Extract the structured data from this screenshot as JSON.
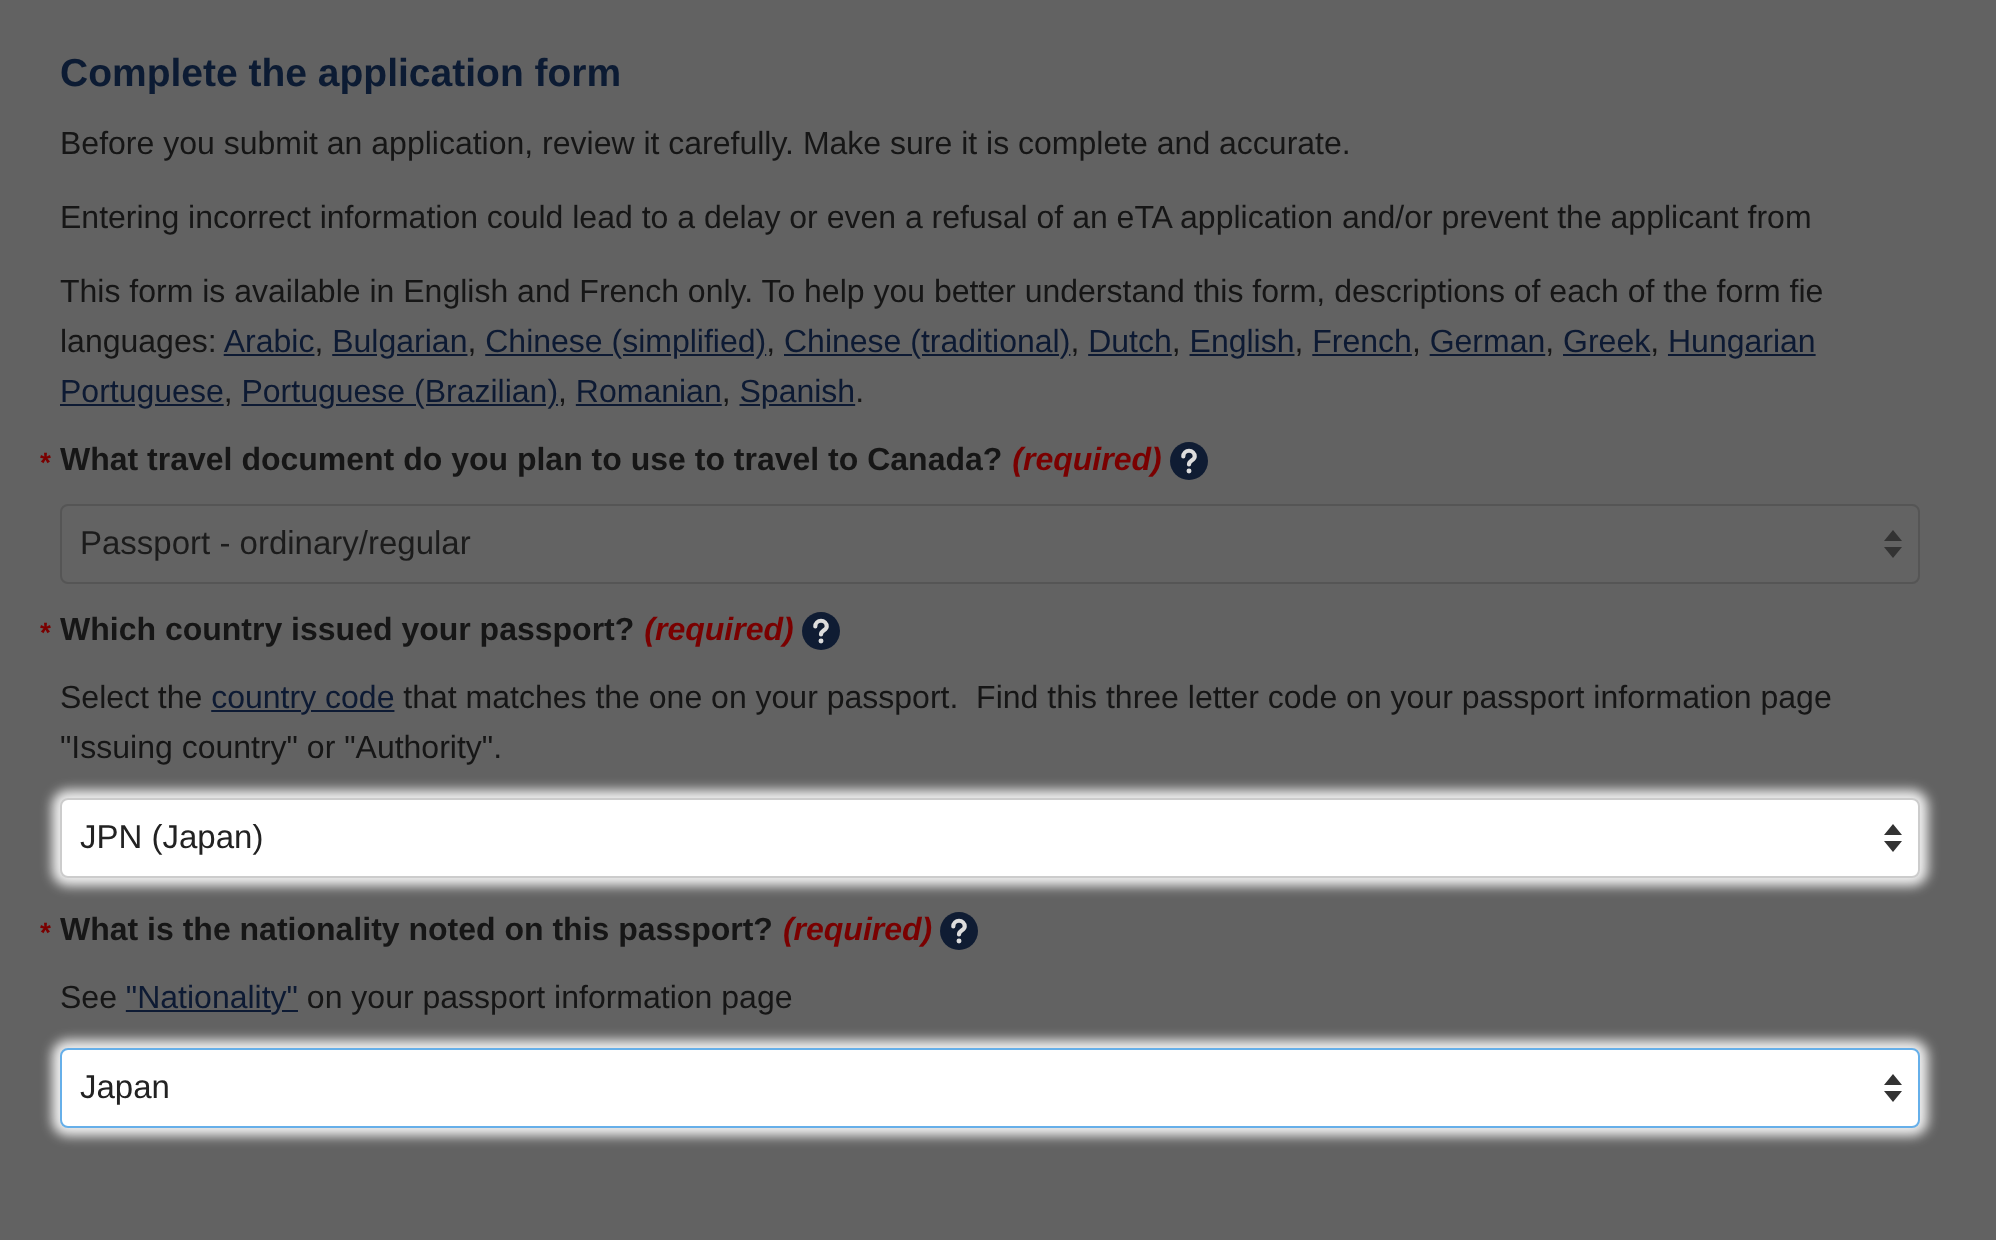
{
  "title": "Complete the application form",
  "intro": [
    {
      "lines": [
        [
          {
            "text": "Before you submit an application, review it carefully. Make sure it is complete and accurate."
          }
        ]
      ]
    },
    {
      "lines": [
        [
          {
            "text": "Entering incorrect information could lead to a delay or even a refusal of an eTA application and/or prevent the applicant from"
          }
        ]
      ]
    },
    {
      "lines": [
        [
          {
            "text": "This form is available in English and French only. To help you better understand this form, descriptions of each of the form fie"
          }
        ],
        [
          {
            "text": "languages: "
          },
          {
            "link": "Arabic"
          },
          {
            "text": ", "
          },
          {
            "link": "Bulgarian"
          },
          {
            "text": ", "
          },
          {
            "link": "Chinese (simplified)"
          },
          {
            "text": ", "
          },
          {
            "link": "Chinese (traditional)"
          },
          {
            "text": ", "
          },
          {
            "link": "Dutch"
          },
          {
            "text": ", "
          },
          {
            "link": "English"
          },
          {
            "text": ", "
          },
          {
            "link": "French"
          },
          {
            "text": ", "
          },
          {
            "link": "German"
          },
          {
            "text": ", "
          },
          {
            "link": "Greek"
          },
          {
            "text": ", "
          },
          {
            "link": "Hungarian"
          }
        ],
        [
          {
            "link": "Portuguese"
          },
          {
            "text": ", "
          },
          {
            "link": "Portuguese (Brazilian)"
          },
          {
            "text": ", "
          },
          {
            "link": "Romanian"
          },
          {
            "text": ", "
          },
          {
            "link": "Spanish"
          },
          {
            "text": "."
          }
        ]
      ]
    }
  ],
  "questions": [
    {
      "asterisk": "*",
      "label": "What travel document do you plan to use to travel to Canada?",
      "required": "(required)",
      "value": "Passport - ordinary/regular",
      "highlighted": false,
      "focused": false
    },
    {
      "asterisk": "*",
      "label": "Which country issued your passport?",
      "required": "(required)",
      "help": [
        [
          {
            "text": "Select the "
          },
          {
            "link": "country code"
          },
          {
            "text": " that matches the one on your passport.  Find this three letter code on your passport information page"
          }
        ],
        [
          {
            "text": "\"Issuing country\" or \"Authority\"."
          }
        ]
      ],
      "value": "JPN (Japan)",
      "highlighted": true,
      "focused": false
    },
    {
      "asterisk": "*",
      "label": "What is the nationality noted on this passport?",
      "required": "(required)",
      "help": [
        [
          {
            "text": "See "
          },
          {
            "link": "\"Nationality\""
          },
          {
            "text": " on your passport information page"
          }
        ]
      ],
      "value": "Japan",
      "highlighted": true,
      "focused": true
    }
  ]
}
